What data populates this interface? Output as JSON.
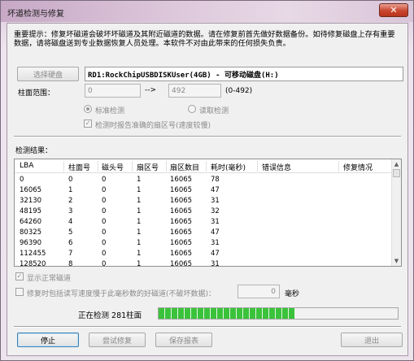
{
  "window": {
    "title": "坏道检测与修复",
    "close_glyph": "✕"
  },
  "notice": "重要提示：修复坏磁道会破坏坏磁道及其附近磁道的数据。请在修复前首先做好数据备份。如待修复磁盘上存有重要数据，请将磁盘送到专业数据恢复人员处理。本软件不对由此带来的任何损失负责。",
  "disk": {
    "select_button": "选择硬盘",
    "name": "RD1:RockChipUSBDISKUser(4GB) - 可移动磁盘(H:)"
  },
  "cylinder": {
    "label": "柱面范围：",
    "from": "0",
    "arrow": "-->",
    "to": "492",
    "range": "(0-492)"
  },
  "options": {
    "standard": "标准检测",
    "read": "读取检测",
    "report": "检测时报告准确的扇区号(速度较慢)",
    "report_check": "✓"
  },
  "results": {
    "label": "检测结果：",
    "columns": [
      "LBA",
      "柱面号",
      "磁头号",
      "扇区号",
      "扇区数目",
      "耗时(毫秒)",
      "错误信息",
      "修复情况"
    ],
    "rows": [
      [
        "0",
        "0",
        "0",
        "1",
        "16065",
        "78"
      ],
      [
        "16065",
        "1",
        "0",
        "1",
        "16065",
        "47"
      ],
      [
        "32130",
        "2",
        "0",
        "1",
        "16065",
        "31"
      ],
      [
        "48195",
        "3",
        "0",
        "1",
        "16065",
        "32"
      ],
      [
        "64260",
        "4",
        "0",
        "1",
        "16065",
        "31"
      ],
      [
        "80325",
        "5",
        "0",
        "1",
        "16065",
        "47"
      ],
      [
        "96390",
        "6",
        "0",
        "1",
        "16065",
        "31"
      ],
      [
        "112455",
        "7",
        "0",
        "1",
        "16065",
        "47"
      ],
      [
        "128520",
        "8",
        "0",
        "1",
        "16065",
        "31"
      ]
    ]
  },
  "show_normal": {
    "label": "显示正常磁道",
    "check": "✓"
  },
  "repair_slow": {
    "label": "修复时包括读写速度慢于此毫秒数的好磁道(不破坏数据)：",
    "value": "0",
    "unit": "毫秒"
  },
  "status": {
    "text": "正在检测 281柱面",
    "progress_fraction": 0.571
  },
  "buttons": {
    "stop": "停止",
    "repair": "尝试修复",
    "save": "保存报表",
    "exit": "退出"
  },
  "colors": {
    "progress": "#3bc23b",
    "frame": "#ddc9dc"
  }
}
